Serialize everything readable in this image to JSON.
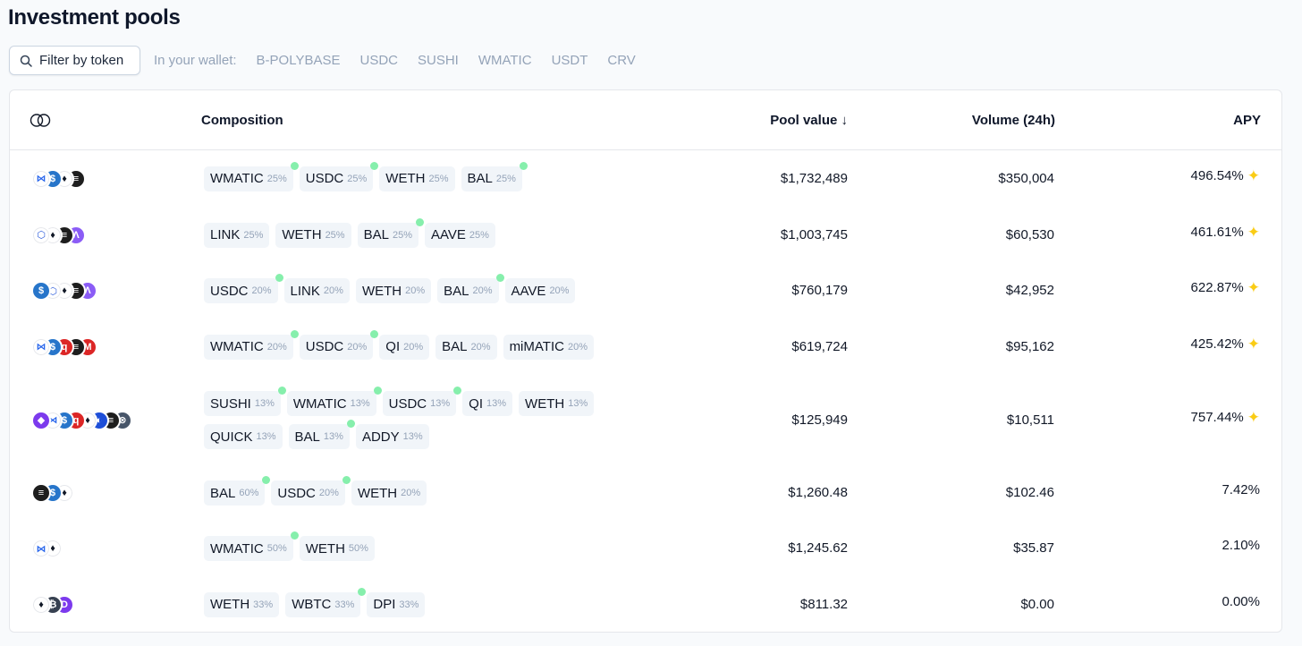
{
  "title": "Investment pools",
  "filter": {
    "label": "Filter by token"
  },
  "wallet": {
    "label": "In your wallet:",
    "tokens": [
      "B-POLYBASE",
      "USDC",
      "SUSHI",
      "WMATIC",
      "USDT",
      "CRV"
    ]
  },
  "table": {
    "headers": {
      "composition": "Composition",
      "pool_value": "Pool value ↓",
      "volume": "Volume (24h)",
      "apy": "APY"
    },
    "rows": [
      {
        "icons": [
          "matic",
          "usdc",
          "eth",
          "bal"
        ],
        "tokens": [
          {
            "sym": "WMATIC",
            "pct": "25%",
            "dot": true
          },
          {
            "sym": "USDC",
            "pct": "25%",
            "dot": true
          },
          {
            "sym": "WETH",
            "pct": "25%",
            "dot": false
          },
          {
            "sym": "BAL",
            "pct": "25%",
            "dot": true
          }
        ],
        "pool_value": "$1,732,489",
        "volume": "$350,004",
        "apy": "496.54%",
        "sparkle": true
      },
      {
        "icons": [
          "link",
          "eth",
          "bal",
          "aave"
        ],
        "tokens": [
          {
            "sym": "LINK",
            "pct": "25%",
            "dot": false
          },
          {
            "sym": "WETH",
            "pct": "25%",
            "dot": false
          },
          {
            "sym": "BAL",
            "pct": "25%",
            "dot": true
          },
          {
            "sym": "AAVE",
            "pct": "25%",
            "dot": false
          }
        ],
        "pool_value": "$1,003,745",
        "volume": "$60,530",
        "apy": "461.61%",
        "sparkle": true
      },
      {
        "icons": [
          "usdc",
          "link",
          "eth",
          "bal",
          "aave"
        ],
        "tokens": [
          {
            "sym": "USDC",
            "pct": "20%",
            "dot": true
          },
          {
            "sym": "LINK",
            "pct": "20%",
            "dot": false
          },
          {
            "sym": "WETH",
            "pct": "20%",
            "dot": false
          },
          {
            "sym": "BAL",
            "pct": "20%",
            "dot": true
          },
          {
            "sym": "AAVE",
            "pct": "20%",
            "dot": false
          }
        ],
        "pool_value": "$760,179",
        "volume": "$42,952",
        "apy": "622.87%",
        "sparkle": true
      },
      {
        "icons": [
          "matic",
          "usdc",
          "qi",
          "bal",
          "mimatic"
        ],
        "tokens": [
          {
            "sym": "WMATIC",
            "pct": "20%",
            "dot": true
          },
          {
            "sym": "USDC",
            "pct": "20%",
            "dot": true
          },
          {
            "sym": "QI",
            "pct": "20%",
            "dot": false
          },
          {
            "sym": "BAL",
            "pct": "20%",
            "dot": false
          },
          {
            "sym": "miMATIC",
            "pct": "20%",
            "dot": false
          }
        ],
        "pool_value": "$619,724",
        "volume": "$95,162",
        "apy": "425.42%",
        "sparkle": true
      },
      {
        "icons": [
          "sushi",
          "matic",
          "usdc",
          "qi",
          "eth",
          "quick",
          "bal",
          "addy"
        ],
        "tokens": [
          {
            "sym": "SUSHI",
            "pct": "13%",
            "dot": true
          },
          {
            "sym": "WMATIC",
            "pct": "13%",
            "dot": true
          },
          {
            "sym": "USDC",
            "pct": "13%",
            "dot": true
          },
          {
            "sym": "QI",
            "pct": "13%",
            "dot": false
          },
          {
            "sym": "WETH",
            "pct": "13%",
            "dot": false
          },
          {
            "sym": "QUICK",
            "pct": "13%",
            "dot": false
          },
          {
            "sym": "BAL",
            "pct": "13%",
            "dot": true
          },
          {
            "sym": "ADDY",
            "pct": "13%",
            "dot": false
          }
        ],
        "pool_value": "$125,949",
        "volume": "$10,511",
        "apy": "757.44%",
        "sparkle": true
      },
      {
        "icons": [
          "bal",
          "usdc",
          "eth"
        ],
        "tokens": [
          {
            "sym": "BAL",
            "pct": "60%",
            "dot": true
          },
          {
            "sym": "USDC",
            "pct": "20%",
            "dot": true
          },
          {
            "sym": "WETH",
            "pct": "20%",
            "dot": false
          }
        ],
        "pool_value": "$1,260.48",
        "volume": "$102.46",
        "apy": "7.42%",
        "sparkle": false
      },
      {
        "icons": [
          "matic",
          "eth"
        ],
        "tokens": [
          {
            "sym": "WMATIC",
            "pct": "50%",
            "dot": true
          },
          {
            "sym": "WETH",
            "pct": "50%",
            "dot": false
          }
        ],
        "pool_value": "$1,245.62",
        "volume": "$35.87",
        "apy": "2.10%",
        "sparkle": false
      },
      {
        "icons": [
          "eth",
          "wbtc",
          "dpi"
        ],
        "tokens": [
          {
            "sym": "WETH",
            "pct": "33%",
            "dot": false
          },
          {
            "sym": "WBTC",
            "pct": "33%",
            "dot": true
          },
          {
            "sym": "DPI",
            "pct": "33%",
            "dot": false
          }
        ],
        "pool_value": "$811.32",
        "volume": "$0.00",
        "apy": "0.00%",
        "sparkle": false
      }
    ]
  },
  "icon_styles": {
    "matic": {
      "bg": "#ffffff",
      "fg": "#2563eb",
      "glyph": "⋈"
    },
    "usdc": {
      "bg": "#2775ca",
      "fg": "#ffffff",
      "glyph": "$"
    },
    "eth": {
      "bg": "#ffffff",
      "fg": "#111827",
      "glyph": "♦"
    },
    "bal": {
      "bg": "#1e1e1e",
      "fg": "#ffffff",
      "glyph": "≡"
    },
    "link": {
      "bg": "#ffffff",
      "fg": "#2a5ada",
      "glyph": "⬡"
    },
    "aave": {
      "bg": "#8b5cf6",
      "fg": "#ffffff",
      "glyph": "Λ"
    },
    "qi": {
      "bg": "#dc2626",
      "fg": "#ffffff",
      "glyph": "q"
    },
    "mimatic": {
      "bg": "#dc2626",
      "fg": "#ffffff",
      "glyph": "M"
    },
    "sushi": {
      "bg": "#7c3aed",
      "fg": "#ffffff",
      "glyph": "◆"
    },
    "quick": {
      "bg": "#1d4ed8",
      "fg": "#ffffff",
      "glyph": "◐"
    },
    "addy": {
      "bg": "#475569",
      "fg": "#ffffff",
      "glyph": "⊗"
    },
    "wbtc": {
      "bg": "#374151",
      "fg": "#ffffff",
      "glyph": "₿"
    },
    "dpi": {
      "bg": "#7c3aed",
      "fg": "#ffffff",
      "glyph": "D"
    }
  }
}
